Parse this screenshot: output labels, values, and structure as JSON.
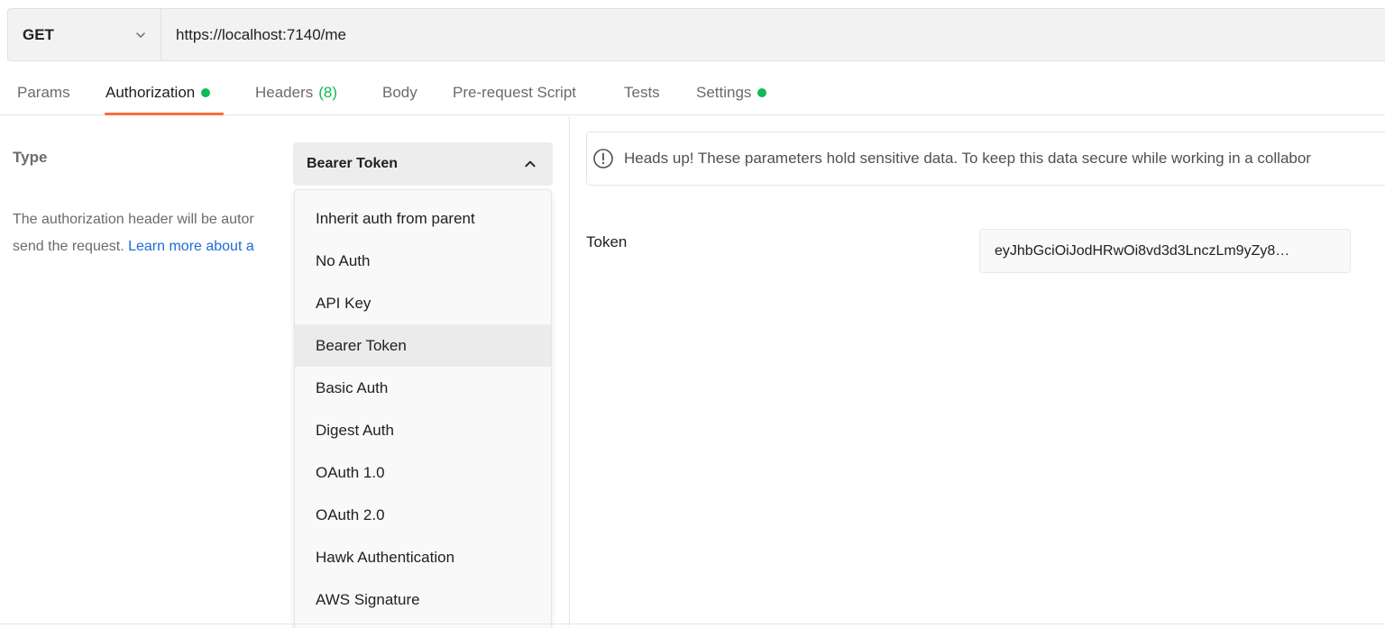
{
  "request": {
    "method": "GET",
    "url": "https://localhost:7140/me"
  },
  "tabs": [
    {
      "label": "Params"
    },
    {
      "label": "Authorization",
      "indicator": "green-dot"
    },
    {
      "label": "Headers",
      "count": "(8)"
    },
    {
      "label": "Body"
    },
    {
      "label": "Pre-request Script"
    },
    {
      "label": "Tests"
    },
    {
      "label": "Settings",
      "indicator": "green-dot"
    }
  ],
  "auth": {
    "type_label": "Type",
    "selected_type": "Bearer Token",
    "description_line1": "The authorization header will be autor",
    "description_line2": "send the request. ",
    "learn_more": "Learn more about a"
  },
  "dropdown": {
    "items": [
      "Inherit auth from parent",
      "No Auth",
      "API Key",
      "Bearer Token",
      "Basic Auth",
      "Digest Auth",
      "OAuth 1.0",
      "OAuth 2.0",
      "Hawk Authentication",
      "AWS Signature"
    ],
    "selected": "Bearer Token"
  },
  "warning": {
    "icon": "info-circle-icon",
    "text": "Heads up! These parameters hold sensitive data. To keep this data secure while working in a collabor"
  },
  "token": {
    "label": "Token",
    "value": "eyJhbGciOiJodHRwOi8vd3d3LnczLm9yZy8…"
  },
  "colors": {
    "accent": "#ff6c37",
    "status_green": "#0cbb52",
    "link": "#1d6bd6"
  }
}
